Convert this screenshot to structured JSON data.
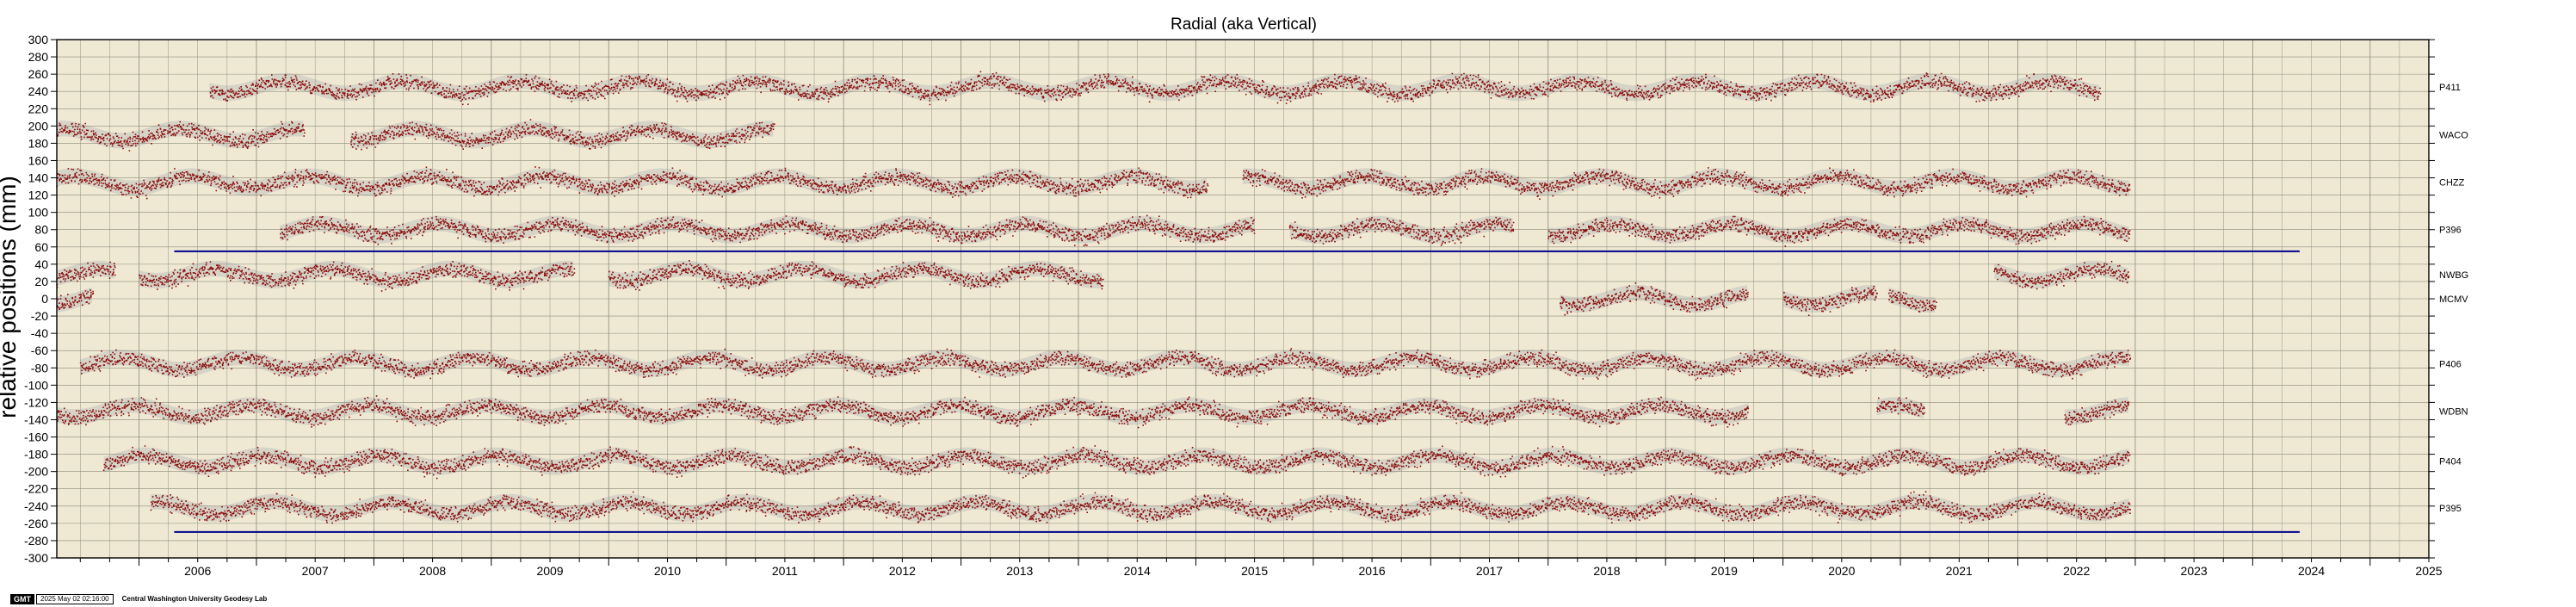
{
  "chart_data": {
    "type": "scatter",
    "title": "Radial (aka Vertical)",
    "xlabel": "",
    "ylabel": "relative positions (mm)",
    "xlim": [
      2005.3,
      2025.5
    ],
    "ylim": [
      -300,
      300
    ],
    "x_ticks": [
      "2006",
      "2007",
      "2008",
      "2009",
      "2010",
      "2011",
      "2012",
      "2013",
      "2014",
      "2015",
      "2016",
      "2017",
      "2018",
      "2019",
      "2020",
      "2021",
      "2022",
      "2023",
      "2024",
      "2025"
    ],
    "y_ticks": [
      "300",
      "280",
      "260",
      "240",
      "220",
      "200",
      "180",
      "160",
      "140",
      "120",
      "100",
      "80",
      "60",
      "40",
      "20",
      "0",
      "-20",
      "-40",
      "-60",
      "-80",
      "-100",
      "-120",
      "-140",
      "-160",
      "-180",
      "-200",
      "-220",
      "-240",
      "-260",
      "-280",
      "-300"
    ],
    "grid": true,
    "series": [
      {
        "name": "P411",
        "offset": 245,
        "segments": [
          [
            2006.6,
            2022.7
          ]
        ]
      },
      {
        "name": "WACO",
        "offset": 190,
        "segments": [
          [
            2005.3,
            2007.4
          ],
          [
            2007.8,
            2011.4
          ]
        ]
      },
      {
        "name": "CHZZ",
        "offset": 135,
        "segments": [
          [
            2005.3,
            2015.1
          ],
          [
            2015.4,
            2022.95
          ]
        ]
      },
      {
        "name": "P396",
        "offset": 80,
        "segments": [
          [
            2007.2,
            2015.5
          ],
          [
            2015.8,
            2017.7
          ],
          [
            2018.0,
            2022.95
          ]
        ]
      },
      {
        "name": "NWBG",
        "offset": 28,
        "segments": [
          [
            2005.3,
            2005.8
          ],
          [
            2006.0,
            2009.7
          ],
          [
            2010.0,
            2014.2
          ],
          [
            2021.8,
            2022.95
          ]
        ]
      },
      {
        "name": "MCMV",
        "offset": 0,
        "segments": [
          [
            2005.3,
            2005.6
          ],
          [
            2018.1,
            2019.7
          ],
          [
            2020.0,
            2020.8
          ],
          [
            2020.9,
            2021.3
          ]
        ]
      },
      {
        "name": "P406",
        "offset": -75,
        "segments": [
          [
            2005.5,
            2022.95
          ]
        ]
      },
      {
        "name": "WDBN",
        "offset": -130,
        "segments": [
          [
            2005.3,
            2019.7
          ],
          [
            2020.8,
            2021.2
          ],
          [
            2022.4,
            2022.95
          ]
        ]
      },
      {
        "name": "P404",
        "offset": -188,
        "segments": [
          [
            2005.7,
            2022.95
          ]
        ]
      },
      {
        "name": "P395",
        "offset": -242,
        "segments": [
          [
            2006.1,
            2022.95
          ]
        ]
      }
    ],
    "reference_lines": [
      {
        "y": 55,
        "x": [
          2006.3,
          2024.4
        ],
        "color": "#000080"
      },
      {
        "y": -270,
        "x": [
          2006.3,
          2024.4
        ],
        "color": "#000080"
      }
    ],
    "colors": {
      "plot_background": "#efe9d3",
      "grid": "#8c8a7c",
      "points": "#8a0d0d",
      "error_band": "#b9b9b9",
      "reference_line": "#00008b"
    }
  },
  "footer": {
    "logo": "GMT",
    "timestamp": "2025 May 02 02:16:00",
    "lab": "Central Washington University Geodesy Lab"
  }
}
